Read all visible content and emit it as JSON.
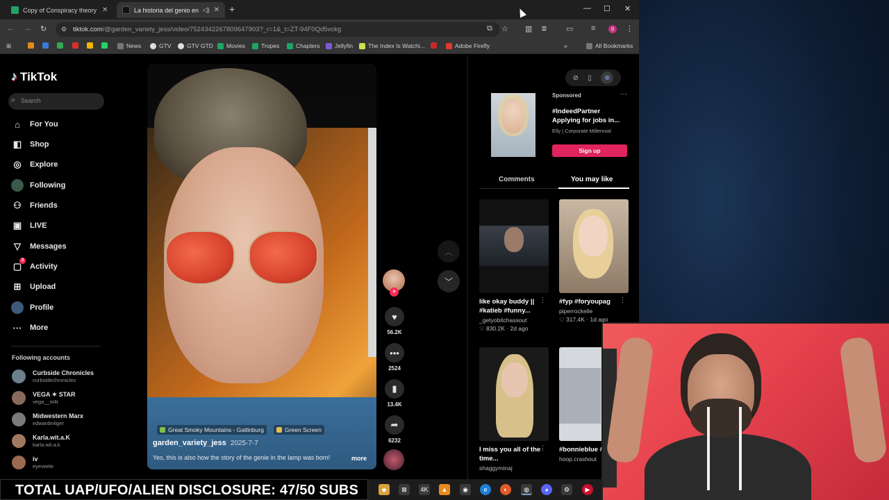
{
  "browser": {
    "tabs": [
      {
        "title": "Copy of Conspiracy theory / tro",
        "favicon_color": "#1fa463"
      },
      {
        "title": "La historia del genio en la l",
        "favicon_color": "#111111"
      }
    ],
    "url_host": "tiktok.com",
    "url_path": "/@garden_variety_jess/video/7524342267809647903?_r=1&_t=ZT-94F0Qd5vckg",
    "profile_initial": "g",
    "bookmarks": [
      "News",
      "GTV",
      "GTV GTD",
      "Movies",
      "Tropes",
      "Chapters",
      "Jellyfin",
      "The Index Is Watchi...",
      "Adobe Firefly"
    ],
    "all_bookmarks": "All Bookmarks"
  },
  "tiktok": {
    "brand": "TikTok",
    "search_placeholder": "Search",
    "nav": [
      {
        "label": "For You",
        "icon": "home-icon"
      },
      {
        "label": "Shop",
        "icon": "shop-icon"
      },
      {
        "label": "Explore",
        "icon": "compass-icon"
      },
      {
        "label": "Following",
        "icon": "following-icon"
      },
      {
        "label": "Friends",
        "icon": "friends-icon"
      },
      {
        "label": "LIVE",
        "icon": "live-icon"
      },
      {
        "label": "Messages",
        "icon": "messages-icon"
      },
      {
        "label": "Activity",
        "icon": "activity-icon",
        "badge": "3"
      },
      {
        "label": "Upload",
        "icon": "upload-icon"
      },
      {
        "label": "Profile",
        "icon": "profile-icon"
      },
      {
        "label": "More",
        "icon": "more-icon"
      }
    ],
    "following_heading": "Following accounts",
    "following_accounts": [
      {
        "name": "Curbside Chronicles",
        "handle": "curbsidechronicles",
        "color": "#6c7f8a"
      },
      {
        "name": "VEGA ✶ STAR",
        "handle": "vega__st4r",
        "color": "#8a6a5a"
      },
      {
        "name": "Midwestern Marx",
        "handle": "edwardmliger",
        "color": "#7a7a7a"
      },
      {
        "name": "Karla.wit.a.K",
        "handle": "karla.wit.a.k",
        "color": "#a07a60"
      },
      {
        "name": "iv",
        "handle": "eyeveele",
        "color": "#9a6a50"
      }
    ],
    "video": {
      "tags": [
        "Great Smoky Mountains - Gatlinburg",
        "Green Screen"
      ],
      "author": "garden_variety_jess",
      "date": "2025-7-7",
      "description": "Yes, this is also how the story of the genie in the lamp was born!",
      "more": "more"
    },
    "actions": {
      "likes": "56.2K",
      "comments": "2524",
      "saves": "13.4K",
      "shares": "6232"
    },
    "ad": {
      "sponsored": "Sponsored",
      "title": "#IndeedPartner Applying for jobs in...",
      "subtitle": "Elly | Corporate Millennial",
      "cta": "Sign up"
    },
    "right_tabs": {
      "comments": "Comments",
      "you_may_like": "You may like"
    },
    "cards": [
      {
        "title": "like okay buddy || #katieb #funny...",
        "user": "_getyobitchassout",
        "meta": "♡ 830.2K · 2d ago",
        "thumb_color": "#1b1b1b"
      },
      {
        "title": "#fyp #foryoupag",
        "user": "piperrockelle",
        "meta": "♡ 317.4K · 1d ago",
        "thumb_color": "#b9a58e"
      },
      {
        "title": "I miss you all of the time...",
        "user": "shaggyminaj",
        "meta": "",
        "thumb_color": "#1a1a1a"
      },
      {
        "title": "#bonnieblue #giftok",
        "user": "hoop.crashout",
        "meta": "",
        "thumb_color": "#cfd2d6"
      }
    ]
  },
  "overlay": {
    "ticker": "TOTAL UAP/UFO/ALIEN DISCLOSURE: 47/50 SUBS"
  }
}
